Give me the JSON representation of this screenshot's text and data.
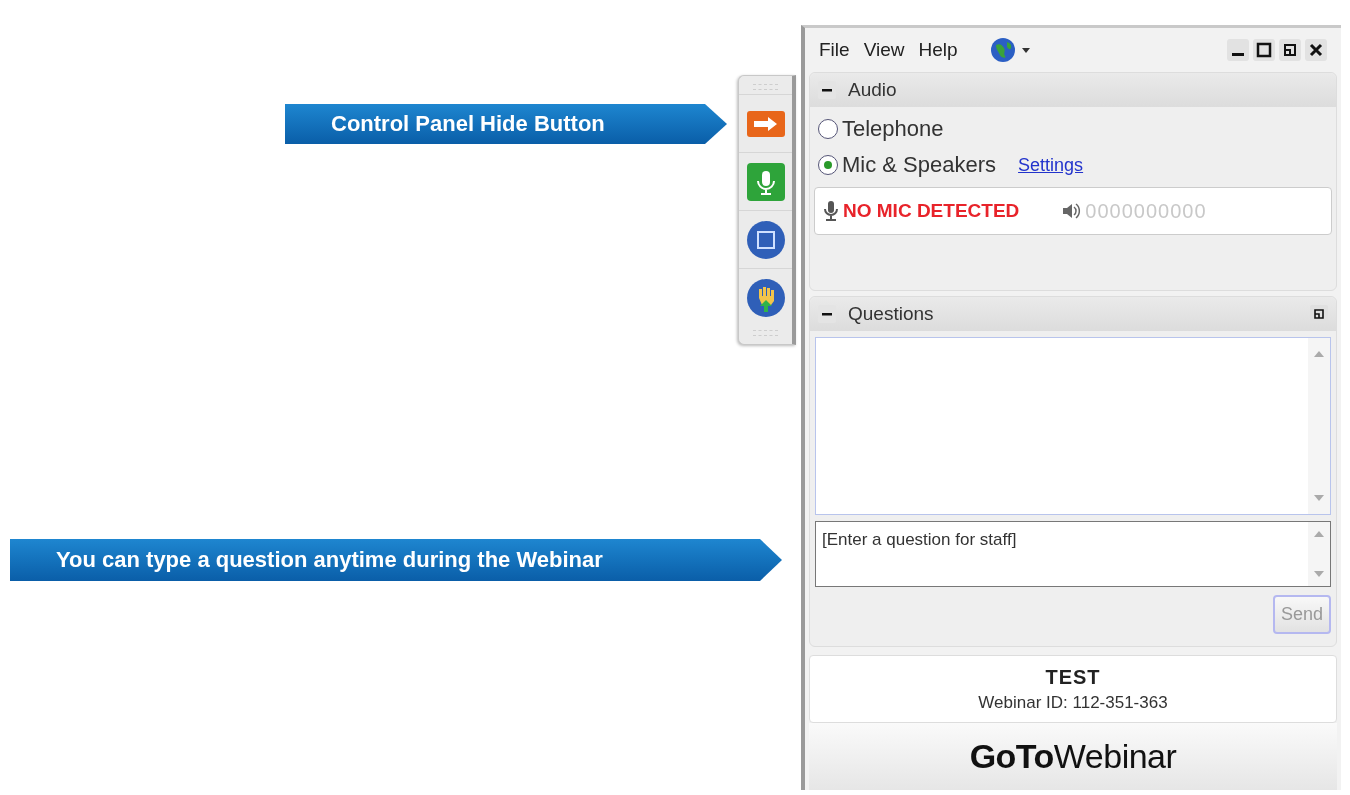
{
  "callouts": [
    {
      "text": "Control Panel Hide Button"
    },
    {
      "text": "You can type a question anytime during the Webinar"
    }
  ],
  "toolbar": {
    "buttons": [
      {
        "kind": "hide"
      },
      {
        "kind": "mic"
      },
      {
        "kind": "screen"
      },
      {
        "kind": "hand"
      }
    ]
  },
  "menu": [
    "File",
    "View",
    "Help"
  ],
  "audio": {
    "title": "Audio",
    "expanded": true,
    "options": [
      {
        "label": "Telephone",
        "selected": false
      },
      {
        "label": "Mic & Speakers",
        "selected": true
      }
    ],
    "settings_link": "Settings",
    "mic_status": "NO MIC DETECTED",
    "speaker_level": "0000000000"
  },
  "questions": {
    "title": "Questions",
    "expanded": true,
    "placeholder": "[Enter a question for staff]",
    "send": "Send",
    "send_disabled": true
  },
  "footer": {
    "title": "TEST",
    "webinar_id": "Webinar ID: 112-351-363",
    "logo": "**GoTo**Webinar"
  }
}
